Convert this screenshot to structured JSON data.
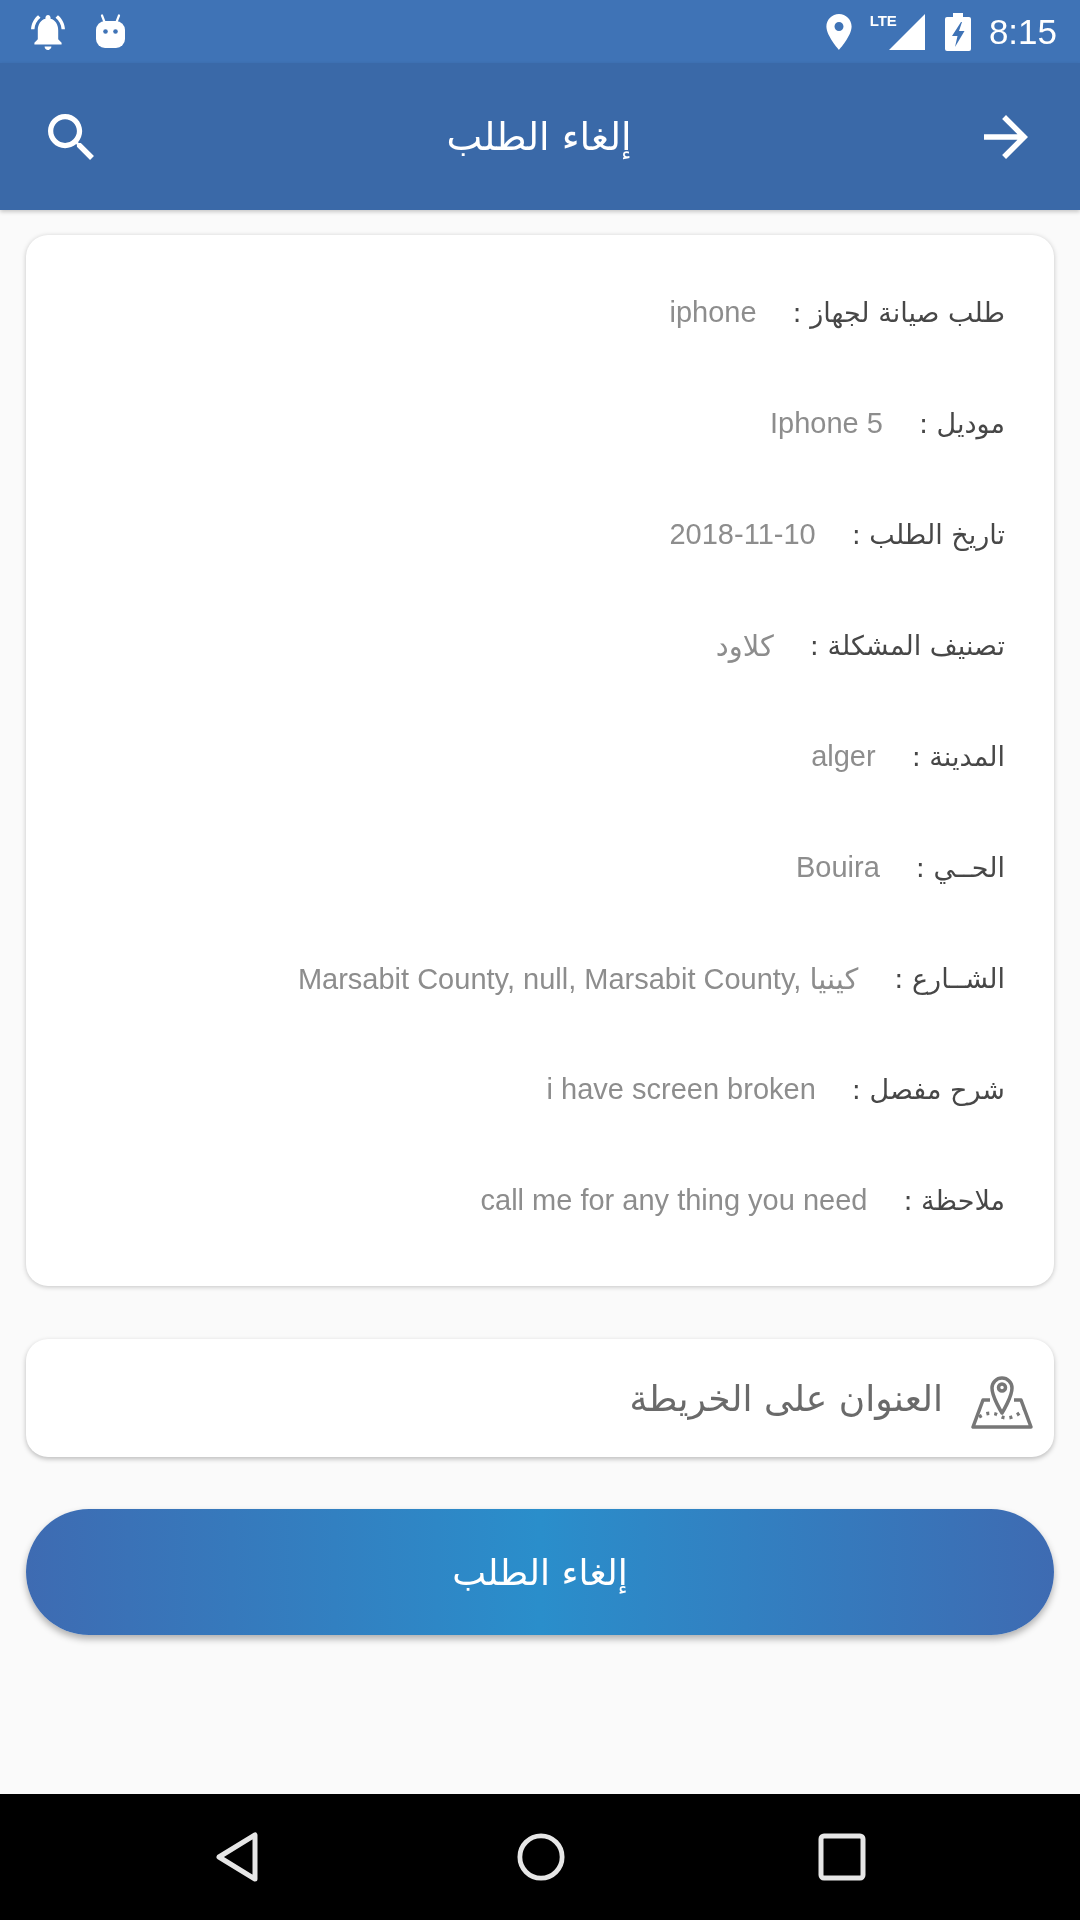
{
  "status_bar": {
    "network": "LTE",
    "time": "8:15"
  },
  "app_bar": {
    "title": "إلغاء الطلب"
  },
  "details": [
    {
      "label": "طلب صيانة لجهاز :",
      "value": "iphone"
    },
    {
      "label": "موديل :",
      "value": "Iphone 5"
    },
    {
      "label": "تاريخ الطلب :",
      "value": "2018-11-10"
    },
    {
      "label": "تصنيف المشكلة :",
      "value": "كلاود"
    },
    {
      "label": "المدينة :",
      "value": "alger"
    },
    {
      "label": "الحــي :",
      "value": "Bouira"
    },
    {
      "label": "الشــارع :",
      "value": "Marsabit County, null, Marsabit County, كينيا"
    },
    {
      "label": "شرح مفصل :",
      "value": "i have screen broken"
    },
    {
      "label": "ملاحظة :",
      "value": "call me for any thing you need"
    }
  ],
  "map_link": {
    "label": "العنوان على الخريطة"
  },
  "cancel_button": {
    "label": "إلغاء الطلب"
  }
}
